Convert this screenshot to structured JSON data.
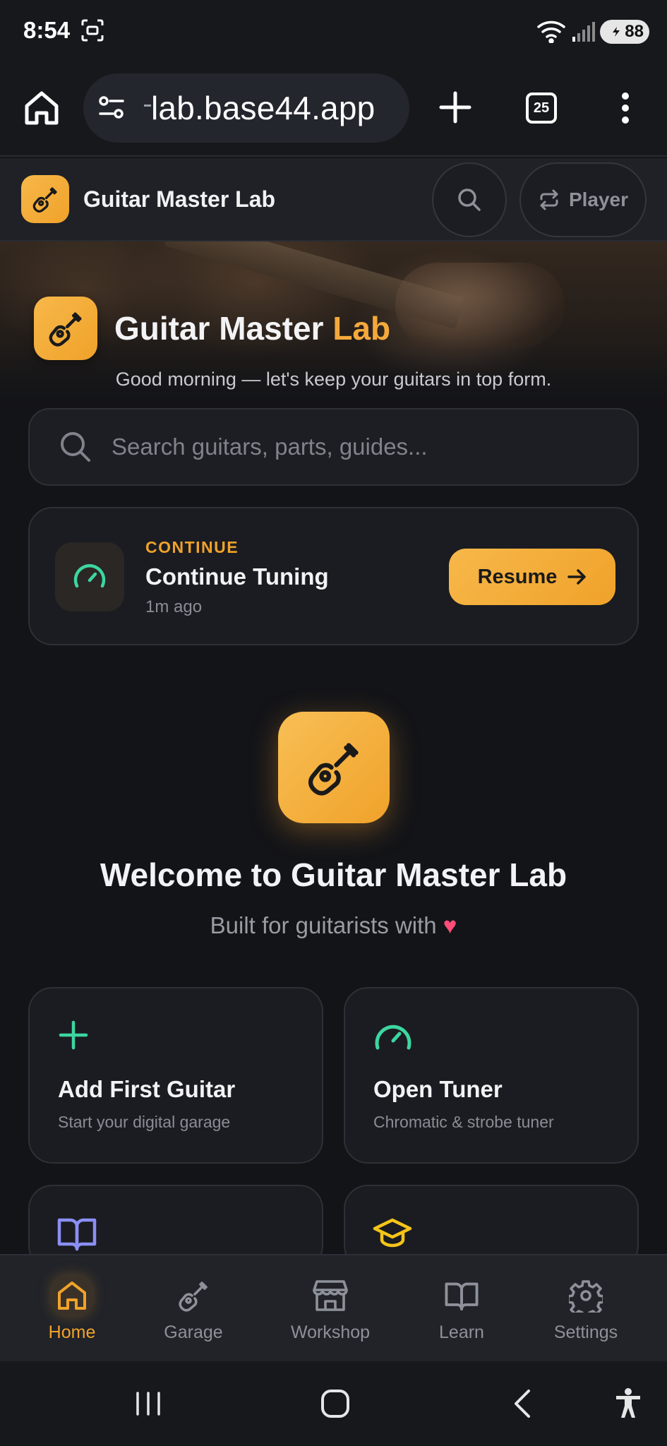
{
  "status_bar": {
    "time": "8:54",
    "battery": "88"
  },
  "browser": {
    "url": "lab.base44.app",
    "tab_count": "25"
  },
  "app_header": {
    "title": "Guitar Master Lab",
    "player_label": "Player"
  },
  "hero": {
    "title_main": "Guitar Master ",
    "title_accent": "Lab",
    "greeting": "Good morning — let's keep your guitars in top form."
  },
  "search": {
    "placeholder": "Search guitars, parts, guides..."
  },
  "continue_card": {
    "label": "CONTINUE",
    "title": "Continue Tuning",
    "time": "1m ago",
    "button_label": "Resume"
  },
  "welcome": {
    "title": "Welcome to Guitar Master Lab",
    "subtitle": "Built for guitarists with",
    "subtitle_emoji": "♥"
  },
  "cards": [
    {
      "title": "Add First Guitar",
      "subtitle": "Start your digital garage",
      "icon": "plus-icon",
      "color": "#3dd6a0"
    },
    {
      "title": "Open Tuner",
      "subtitle": "Chromatic & strobe tuner",
      "icon": "gauge-icon",
      "color": "#3dd6a0"
    },
    {
      "icon": "book-icon",
      "color": "#8b8ff5"
    },
    {
      "icon": "graduation-cap-icon",
      "color": "#f5c518"
    }
  ],
  "bottom_nav": [
    {
      "label": "Home",
      "icon": "home-icon",
      "active": true
    },
    {
      "label": "Garage",
      "icon": "guitar-icon"
    },
    {
      "label": "Workshop",
      "icon": "store-icon"
    },
    {
      "label": "Learn",
      "icon": "book-icon"
    },
    {
      "label": "Settings",
      "icon": "gear-icon"
    }
  ],
  "colors": {
    "accent": "#f0a22a",
    "teal": "#3dd6a0",
    "background": "#131418"
  }
}
